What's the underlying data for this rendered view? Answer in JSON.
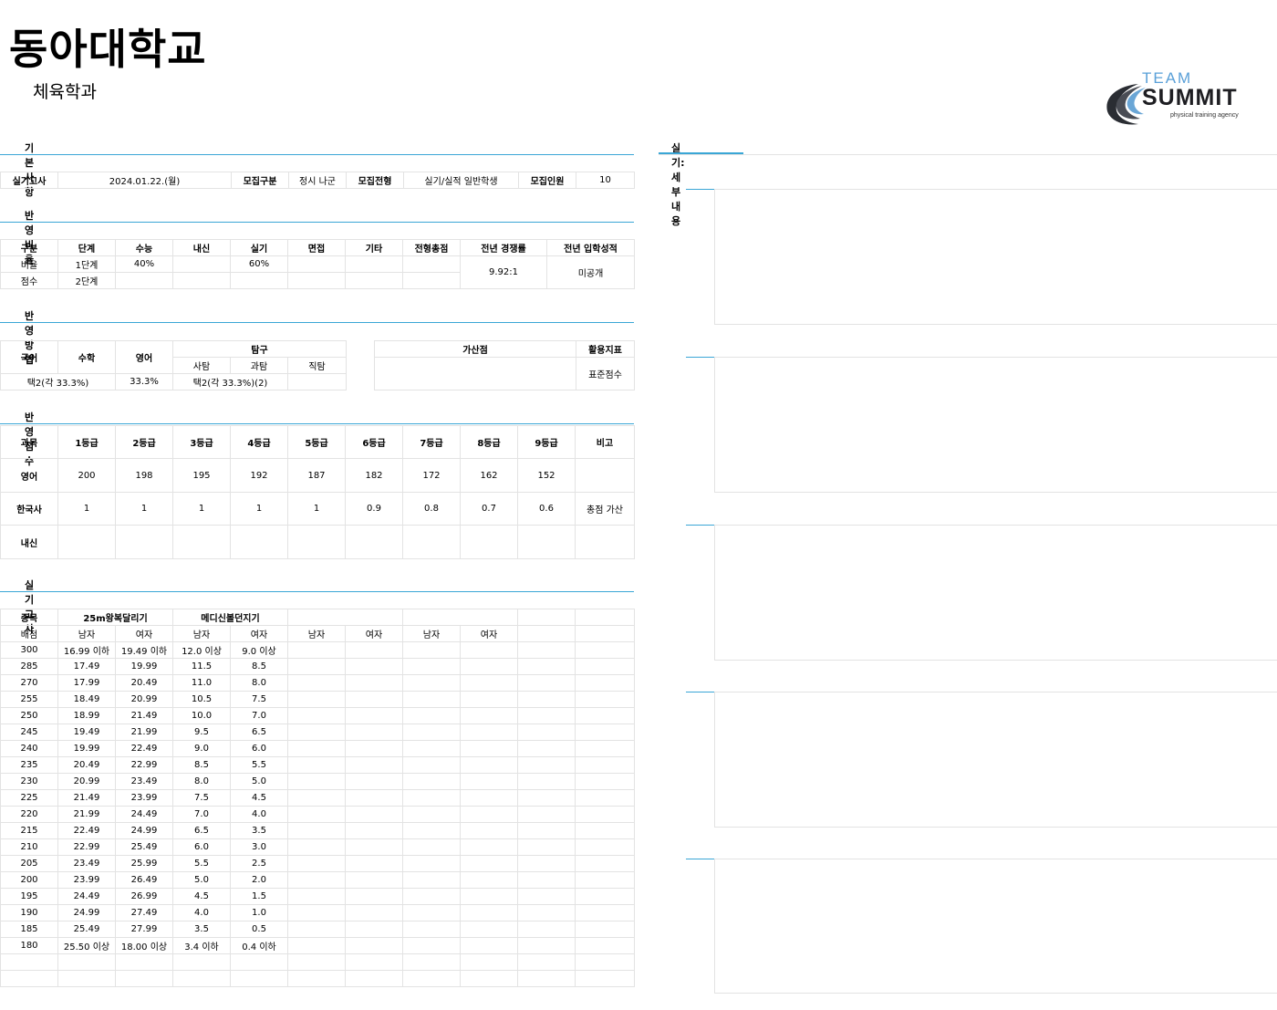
{
  "header": {
    "title": "동아대학교",
    "subtitle": "체육학과"
  },
  "logo": {
    "line1": "TEAM",
    "line2": "SUMMIT",
    "line3": "physical training agency"
  },
  "sections": {
    "basic": "기본사항",
    "ratio": "반영비율",
    "method": "반영방법",
    "score": "반영점수",
    "practical": "실기고사",
    "detail": "실기:세부내용"
  },
  "basic": {
    "exam_label": "실기고사",
    "exam_date": "2024.01.22.(월)",
    "recruit_label": "모집구분",
    "recruit": "정시 나군",
    "type_label": "모집전형",
    "type": "실기/실적 일반학생",
    "count_label": "모집인원",
    "count": "10"
  },
  "ratio": {
    "headers": [
      "구분",
      "단계",
      "수능",
      "내신",
      "실기",
      "면접",
      "기타",
      "전형총점",
      "전년 경쟁률",
      "전년 입학성적"
    ],
    "row1": [
      "비율",
      "1단계",
      "40%",
      "",
      "60%",
      "",
      "",
      ""
    ],
    "row2": [
      "점수",
      "2단계",
      "",
      "",
      "",
      "",
      "",
      ""
    ],
    "competition": "9.92:1",
    "admission": "미공개"
  },
  "method": {
    "korean": "국어",
    "math": "수학",
    "english": "영어",
    "inquiry": "탐구",
    "social": "사탐",
    "science": "과탐",
    "vocational": "직탐",
    "kor_math_value": "택2(각 33.3%)",
    "english_value": "33.3%",
    "inquiry_value": "택2(각 33.3%)(2)",
    "bonus_label": "가산점",
    "indicator_label": "활용지표",
    "indicator_value": "표준점수"
  },
  "score": {
    "headers": [
      "과목",
      "1등급",
      "2등급",
      "3등급",
      "4등급",
      "5등급",
      "6등급",
      "7등급",
      "8등급",
      "9등급",
      "비고"
    ],
    "rows": [
      [
        "영어",
        "200",
        "198",
        "195",
        "192",
        "187",
        "182",
        "172",
        "162",
        "152",
        ""
      ],
      [
        "한국사",
        "1",
        "1",
        "1",
        "1",
        "1",
        "0.9",
        "0.8",
        "0.7",
        "0.6",
        "총점 가산"
      ],
      [
        "내신",
        "",
        "",
        "",
        "",
        "",
        "",
        "",
        "",
        "",
        ""
      ]
    ]
  },
  "practical": {
    "event_label": "종목",
    "event1": "25m왕복달리기",
    "event2": "메디신볼던지기",
    "points_label": "배점",
    "male": "남자",
    "female": "여자",
    "rows": [
      [
        "300",
        "16.99 이하",
        "19.49 이하",
        "12.0 이상",
        "9.0 이상"
      ],
      [
        "285",
        "17.49",
        "19.99",
        "11.5",
        "8.5"
      ],
      [
        "270",
        "17.99",
        "20.49",
        "11.0",
        "8.0"
      ],
      [
        "255",
        "18.49",
        "20.99",
        "10.5",
        "7.5"
      ],
      [
        "250",
        "18.99",
        "21.49",
        "10.0",
        "7.0"
      ],
      [
        "245",
        "19.49",
        "21.99",
        "9.5",
        "6.5"
      ],
      [
        "240",
        "19.99",
        "22.49",
        "9.0",
        "6.0"
      ],
      [
        "235",
        "20.49",
        "22.99",
        "8.5",
        "5.5"
      ],
      [
        "230",
        "20.99",
        "23.49",
        "8.0",
        "5.0"
      ],
      [
        "225",
        "21.49",
        "23.99",
        "7.5",
        "4.5"
      ],
      [
        "220",
        "21.99",
        "24.49",
        "7.0",
        "4.0"
      ],
      [
        "215",
        "22.49",
        "24.99",
        "6.5",
        "3.5"
      ],
      [
        "210",
        "22.99",
        "25.49",
        "6.0",
        "3.0"
      ],
      [
        "205",
        "23.49",
        "25.99",
        "5.5",
        "2.5"
      ],
      [
        "200",
        "23.99",
        "26.49",
        "5.0",
        "2.0"
      ],
      [
        "195",
        "24.49",
        "26.99",
        "4.5",
        "1.5"
      ],
      [
        "190",
        "24.99",
        "27.49",
        "4.0",
        "1.0"
      ],
      [
        "185",
        "25.49",
        "27.99",
        "3.5",
        "0.5"
      ],
      [
        "180",
        "25.50 이상",
        "18.00 이상",
        "3.4 이하",
        "0.4 이하"
      ]
    ]
  },
  "colors": {
    "accent": "#3aa6d6",
    "border": "#e3e3e3"
  }
}
